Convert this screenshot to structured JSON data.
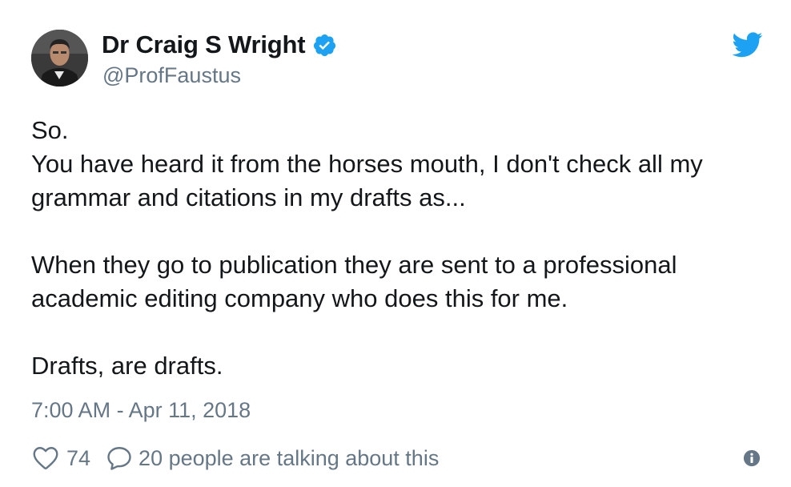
{
  "author": {
    "display_name": "Dr Craig S Wright",
    "handle": "@ProfFaustus",
    "verified_icon": "verified-badge-icon",
    "avatar": "author-avatar"
  },
  "brand_icon": "twitter-bird-icon",
  "tweet": {
    "paragraphs": [
      "So.\nYou have heard it from the horses mouth, I don't check all my\ngrammar and citations in my drafts as...",
      "When they go to publication they are sent to a professional\nacademic editing company who does this for me.",
      "Drafts, are drafts."
    ],
    "timestamp": "7:00 AM - Apr 11, 2018"
  },
  "actions": {
    "like_icon": "heart-icon",
    "like_count": "74",
    "talk_icon": "speech-bubble-icon",
    "talk_text": "20 people are talking about this",
    "info_icon": "info-icon"
  },
  "colors": {
    "text": "#14171a",
    "secondary": "#657786",
    "twitter_blue": "#1da1f2"
  }
}
